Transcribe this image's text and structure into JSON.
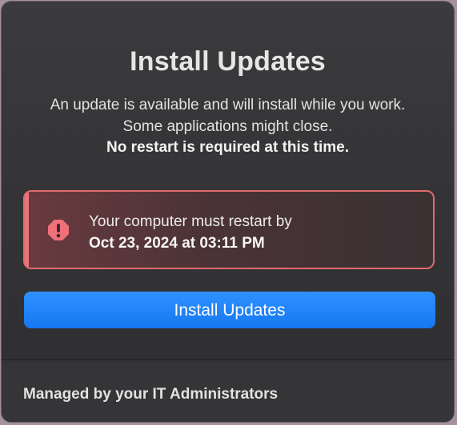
{
  "dialog": {
    "title": "Install Updates",
    "description": {
      "line1": "An update is available and will install while you work.",
      "line2": "Some applications might close.",
      "line3_bold": "No restart is required at this time."
    },
    "alert": {
      "icon": "exclamation-octagon-icon",
      "lead_text": "Your computer must restart by",
      "deadline": "Oct 23, 2024 at 03:11 PM",
      "accent_color": "#e26a6f"
    },
    "primary_button": {
      "label": "Install Updates",
      "color": "#1a7cf5"
    },
    "footer": {
      "text": "Managed by your IT Administrators"
    }
  }
}
